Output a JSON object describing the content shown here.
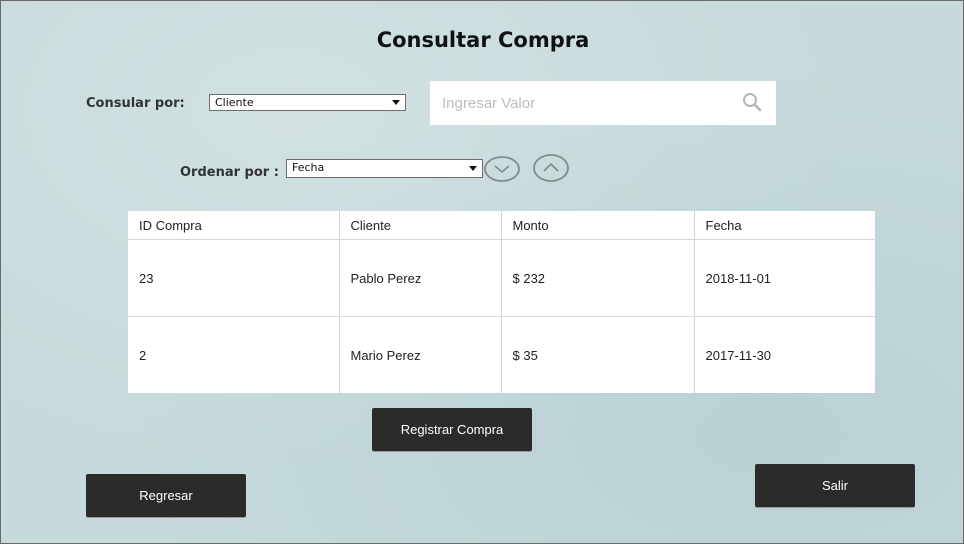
{
  "page": {
    "title": "Consultar Compra"
  },
  "filter": {
    "query_label": "Consular por:",
    "query_selected": "Cliente",
    "search_placeholder": "Ingresar Valor",
    "order_label": "Ordenar por :",
    "order_selected": "Fecha"
  },
  "table": {
    "columns": [
      "ID Compra",
      "Cliente",
      "Monto",
      "Fecha"
    ],
    "rows": [
      [
        "23",
        "Pablo Perez",
        "$ 232",
        "2018-11-01"
      ],
      [
        "2",
        "Mario Perez",
        "$ 35",
        "2017-11-30"
      ]
    ]
  },
  "buttons": {
    "register": "Registrar Compra",
    "back": "Regresar",
    "exit": "Salir"
  },
  "icons": {
    "search": "search-icon",
    "sort_desc": "chevron-down-icon",
    "sort_asc": "chevron-up-icon"
  }
}
